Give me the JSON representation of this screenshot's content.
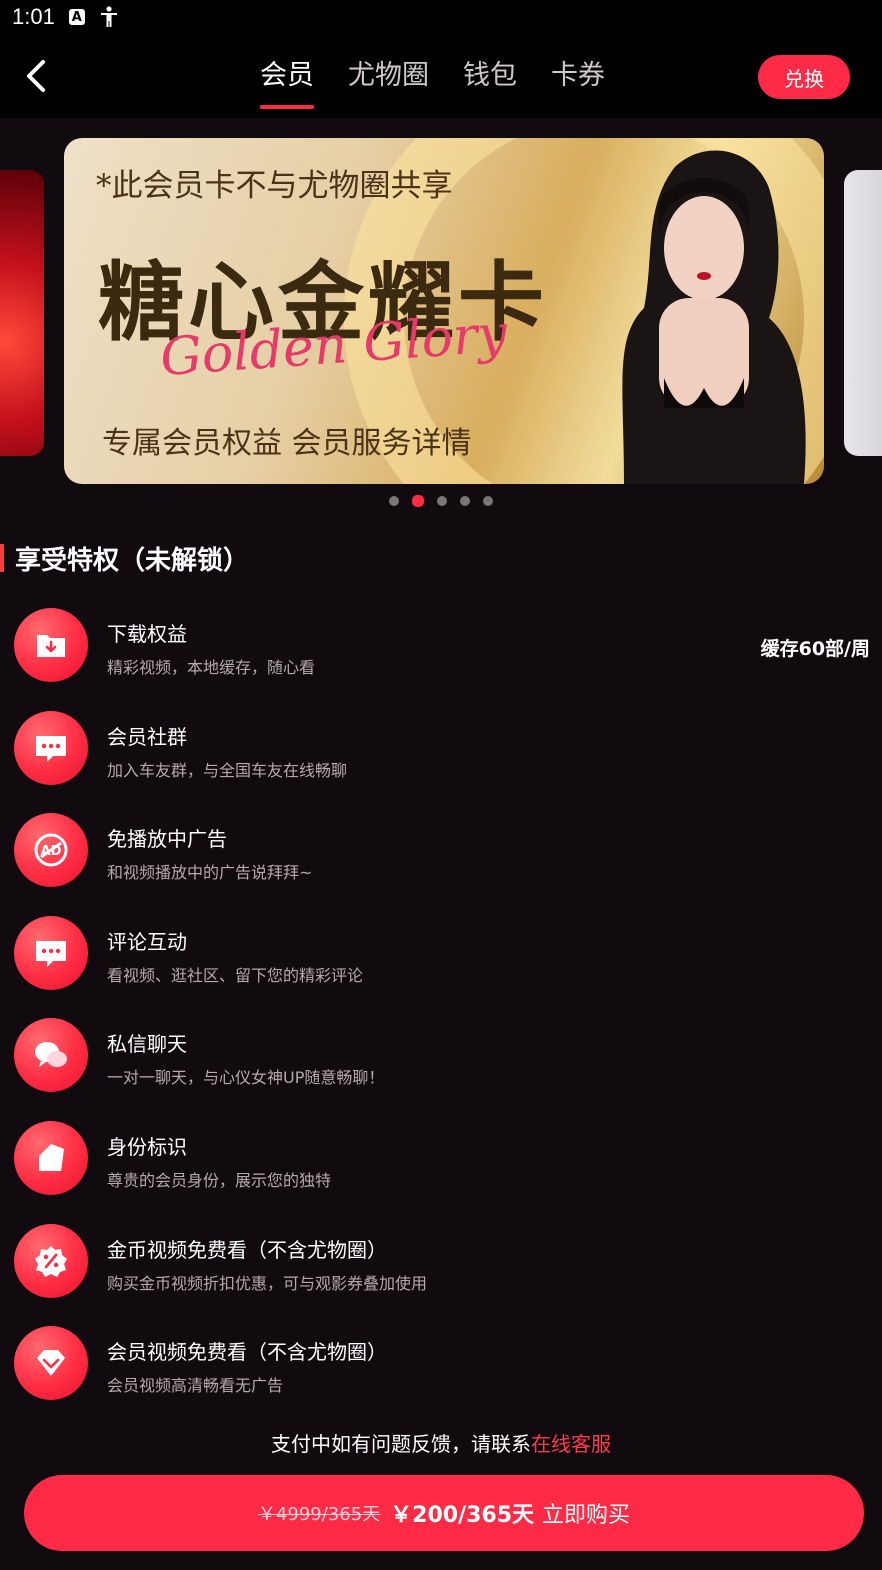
{
  "status_bar": {
    "time": "1:01",
    "icons": [
      "text-a-icon",
      "accessibility-icon"
    ]
  },
  "nav": {
    "tabs": [
      {
        "label": "会员",
        "active": true
      },
      {
        "label": "尤物圈",
        "active": false
      },
      {
        "label": "钱包",
        "active": false
      },
      {
        "label": "卡券",
        "active": false
      }
    ],
    "redeem_label": "兑换"
  },
  "banner": {
    "note": "*此会员卡不与尤物圈共享",
    "title": "糖心金耀卡",
    "script": "Golden Glory",
    "subtitle": "专属会员权益  会员服务详情",
    "dots_total": 5,
    "dots_active_index": 1
  },
  "section": {
    "title": "享受特权（未解锁）"
  },
  "privileges": [
    {
      "icon": "download-folder-icon",
      "title": "下载权益",
      "desc": "精彩视频，本地缓存，随心看",
      "extra": "缓存60部/周"
    },
    {
      "icon": "chat-bubble-icon",
      "title": "会员社群",
      "desc": "加入车友群，与全国车友在线畅聊",
      "extra": ""
    },
    {
      "icon": "no-ad-icon",
      "title": "免播放中广告",
      "desc": "和视频播放中的广告说拜拜~",
      "extra": ""
    },
    {
      "icon": "comment-icon",
      "title": "评论互动",
      "desc": "看视频、逛社区、留下您的精彩评论",
      "extra": ""
    },
    {
      "icon": "private-message-icon",
      "title": "私信聊天",
      "desc": "一对一聊天，与心仪女神UP随意畅聊！",
      "extra": ""
    },
    {
      "icon": "identity-tag-icon",
      "title": "身份标识",
      "desc": "尊贵的会员身份，展示您的独特",
      "extra": ""
    },
    {
      "icon": "discount-badge-icon",
      "title": "金币视频免费看（不含尤物圈）",
      "desc": "购买金币视频折扣优惠，可与观影券叠加使用",
      "extra": ""
    },
    {
      "icon": "diamond-icon",
      "title": "会员视频免费看（不含尤物圈）",
      "desc": "会员视频高清畅看无广告",
      "extra": ""
    }
  ],
  "footer": {
    "feedback_text": "支付中如有问题反馈，请联系",
    "feedback_link": "在线客服",
    "old_price": "￥4999/365天",
    "new_price": "￥200/365天",
    "cta": "立即购买"
  },
  "colors": {
    "accent": "#ff2b46",
    "background": "#110a0e"
  }
}
